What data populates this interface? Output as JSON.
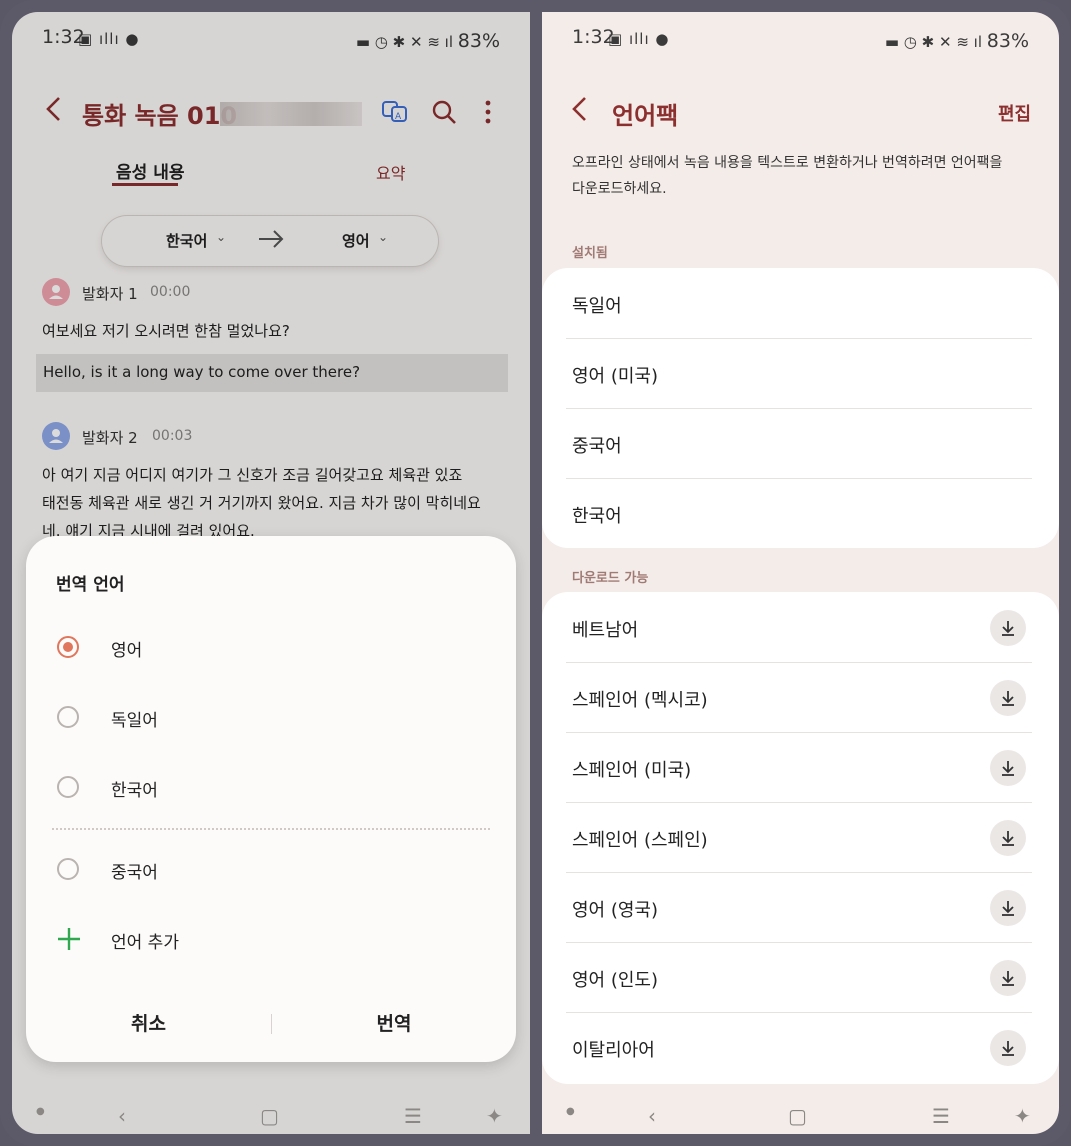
{
  "left": {
    "status": {
      "time": "1:32",
      "battery": "83%"
    },
    "header": {
      "title": "통화 녹음 010"
    },
    "tabs": [
      {
        "label": "음성 내용",
        "active": true
      },
      {
        "label": "요약",
        "active": false
      }
    ],
    "lang_selector": {
      "from": "한국어",
      "to": "영어"
    },
    "transcript": [
      {
        "speaker": "발화자 1",
        "time": "00:00",
        "text": "여보세요 저기 오시려면 한참 멀었나요?",
        "translation": "Hello, is it a long way to come over there?"
      },
      {
        "speaker": "발화자 2",
        "time": "00:03",
        "lines": [
          "아 여기 지금 어디지 여기가 그 신호가 조금 길어갖고요 체육관 있죠",
          "태전동 체육관 새로 생긴 거 거기까지 왔어요. 지금 차가 많이 막히네요",
          "네. 얘기 지금 시내에 걸려 있어요."
        ]
      }
    ],
    "sheet": {
      "title": "번역 언어",
      "options": [
        {
          "label": "영어",
          "selected": true
        },
        {
          "label": "독일어",
          "selected": false
        },
        {
          "label": "한국어",
          "selected": false
        }
      ],
      "extra_option": {
        "label": "중국어",
        "selected": false
      },
      "add_label": "언어 추가",
      "cancel": "취소",
      "confirm": "번역"
    }
  },
  "right": {
    "status": {
      "time": "1:32",
      "battery": "83%"
    },
    "header": {
      "title": "언어팩",
      "action": "편집"
    },
    "description": [
      "오프라인 상태에서 녹음 내용을 텍스트로 변환하거나 번역하려면 언어팩을",
      "다운로드하세요."
    ],
    "installed_title": "설치됨",
    "installed": [
      "독일어",
      "영어 (미국)",
      "중국어",
      "한국어"
    ],
    "available_title": "다운로드 가능",
    "available": [
      "베트남어",
      "스페인어 (멕시코)",
      "스페인어 (미국)",
      "스페인어 (스페인)",
      "영어 (영국)",
      "영어 (인도)",
      "이탈리아어"
    ]
  },
  "colors": {
    "accent": "#8c2f2f",
    "radio": "#e0765c",
    "add": "#2fa84f"
  }
}
